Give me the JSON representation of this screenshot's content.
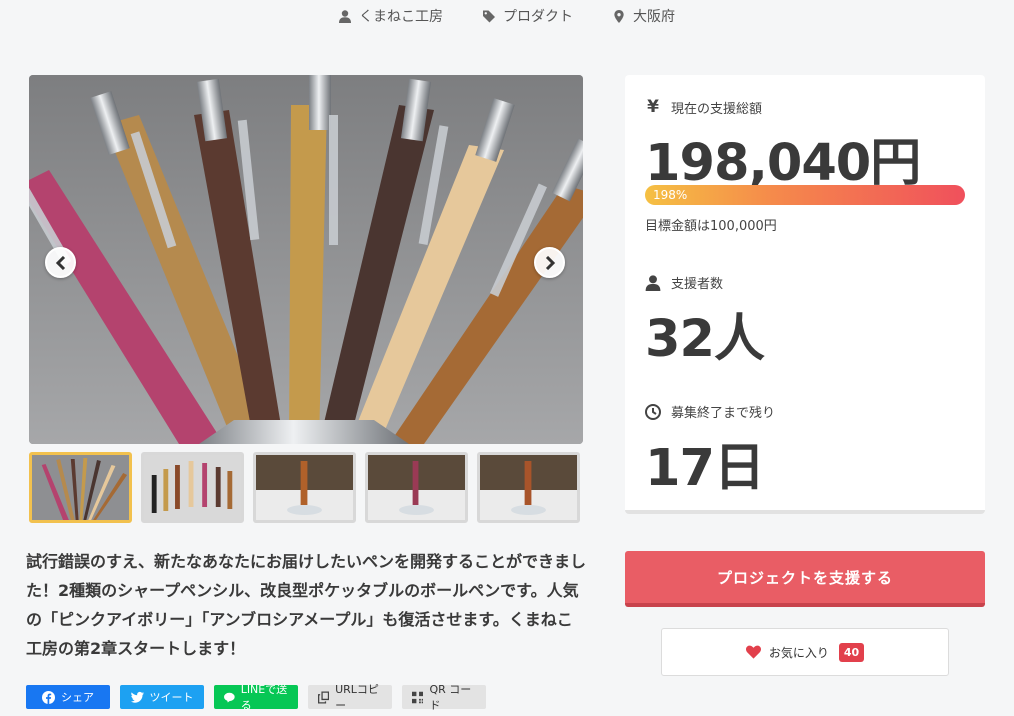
{
  "meta": {
    "creator": "くまねこ工房",
    "category": "プロダクト",
    "location": "大阪府"
  },
  "gallery": {
    "prev_icon": "chevron-left-icon",
    "next_icon": "chevron-right-icon",
    "thumbnail_count": 5,
    "active_thumbnail": 1
  },
  "description": "試行錯誤のすえ、新たなあなたにお届けしたいペンを開発することができました！2種類のシャープペンシル、改良型ポケッタブルのボールペンです。人気の「ピンクアイボリー」「アンブロシアメープル」も復活させます。くまねこ工房の第2章スタートします！",
  "share": {
    "facebook": "シェア",
    "twitter": "ツイート",
    "line": "LINEで送る",
    "copy": "URLコピー",
    "qr": "QR コード"
  },
  "stats": {
    "total_label": "現在の支援総額",
    "total_icon": "¥",
    "total_value": "198,040円",
    "progress_text": "198%",
    "progress_fraction": 1.0,
    "goal_text": "目標金額は100,000円",
    "backers_label": "支援者数",
    "backers_value": "32人",
    "remaining_label": "募集終了まで残り",
    "remaining_value": "17日"
  },
  "actions": {
    "support_label": "プロジェクトを支援する",
    "favorite_label": "お気に入り",
    "favorite_count": "40"
  },
  "colors": {
    "support_button": "#e95d65",
    "favorite_accent": "#e2404c",
    "progress_start": "#f5c043",
    "progress_end": "#f0505c",
    "active_thumb_border": "#f2c14e"
  }
}
